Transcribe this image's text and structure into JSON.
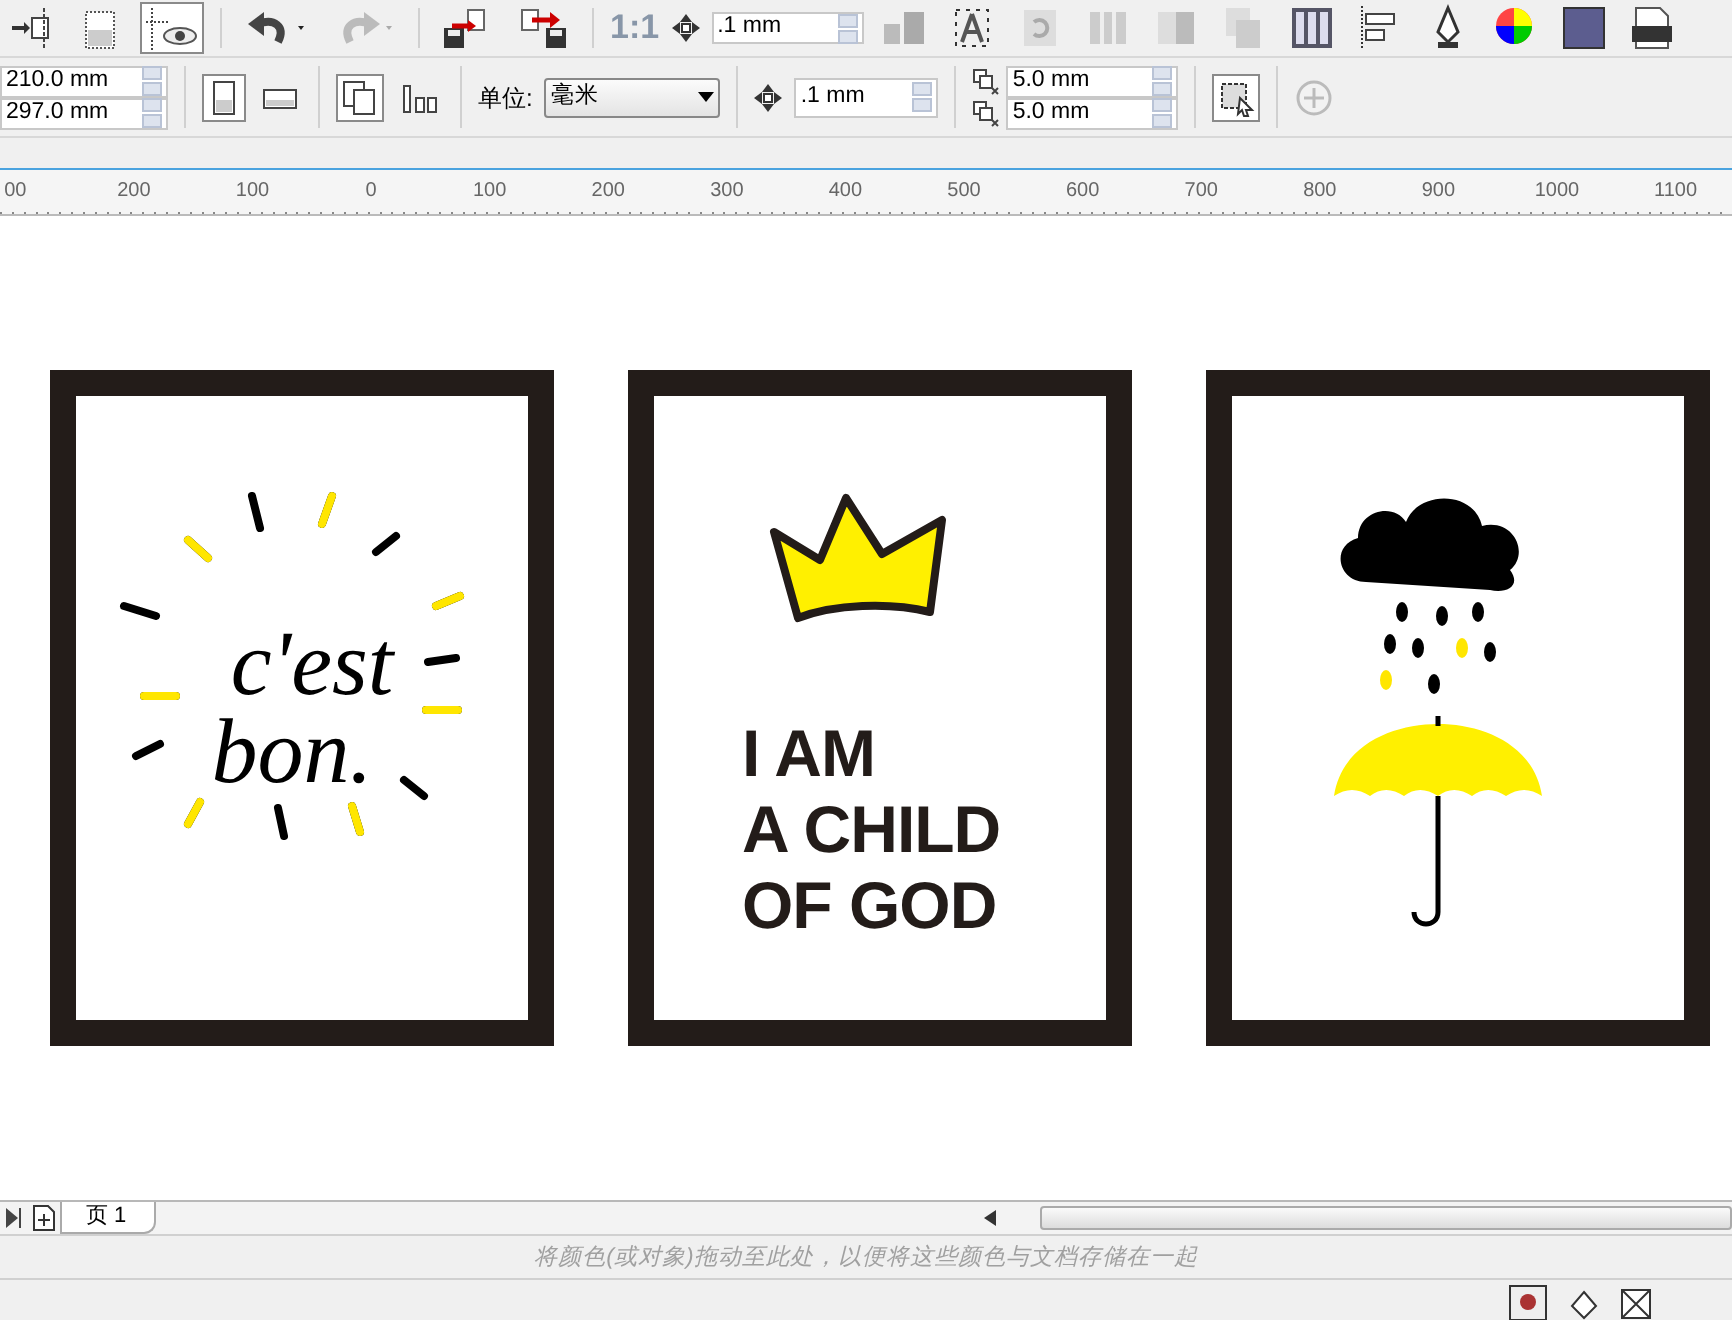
{
  "toolbar": {
    "zoom_label": "1:1",
    "nudge": ".1 mm"
  },
  "property_bar": {
    "width": "210.0 mm",
    "height": "297.0 mm",
    "orientation_buttons": [
      {
        "kind": "portrait",
        "selected": true
      },
      {
        "kind": "landscape",
        "selected": false
      }
    ],
    "units_label": "单位:",
    "units": "毫米",
    "nudge": ".1 mm",
    "duplicate_x": "5.0 mm",
    "duplicate_y": "5.0 mm"
  },
  "ruler": {
    "labels": [
      "00",
      "200",
      "100",
      "0",
      "100",
      "200",
      "300",
      "400",
      "500",
      "600",
      "700",
      "800",
      "900",
      "1000",
      "1100"
    ]
  },
  "posters": [
    {
      "kind": "lettering",
      "lines": [
        "c'est",
        "bon."
      ]
    },
    {
      "kind": "crown",
      "lines": [
        "I AM",
        "A CHILD",
        "OF GOD"
      ]
    },
    {
      "kind": "umbrella"
    }
  ],
  "page_tabs": [
    {
      "label": "页 1",
      "selected": true
    }
  ],
  "palette_hint": "将颜色(或对象)拖动至此处，以便将这些颜色与文档存储在一起"
}
